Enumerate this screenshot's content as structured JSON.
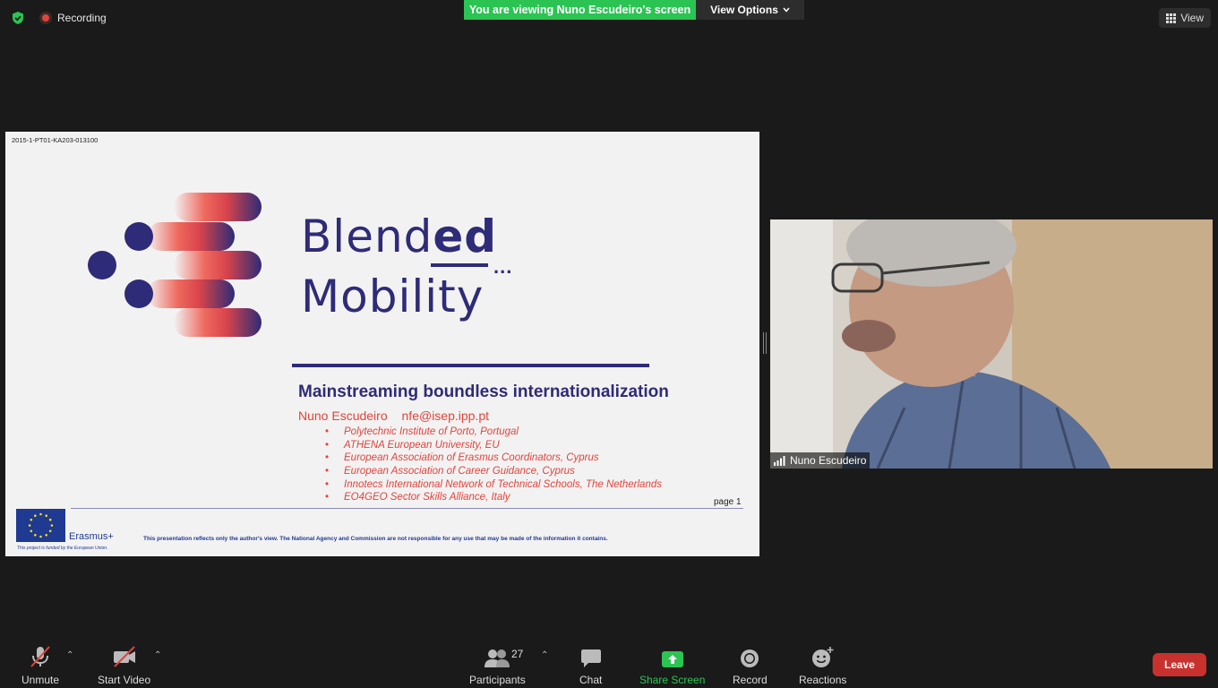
{
  "top_bar": {
    "recording_label": "Recording",
    "viewing_banner": "You are viewing Nuno Escudeiro's screen",
    "view_options_label": "View Options",
    "view_label": "View"
  },
  "slide": {
    "project_code": "2015-1-PT01-KA203-013100",
    "brand_line1_regular": "Blend",
    "brand_line1_bold": "ed",
    "brand_dots": "...",
    "brand_line2": "Mobility",
    "subtitle": "Mainstreaming boundless internationalization",
    "author_name": "Nuno Escudeiro",
    "author_email": "nfe@isep.ipp.pt",
    "affiliations": [
      "Polytechnic Institute of Porto, Portugal",
      "ATHENA European University, EU",
      "European Association of Erasmus Coordinators, Cyprus",
      "European Association of Career Guidance, Cyprus",
      "Innotecs International Network of Technical Schools, The Netherlands",
      "EO4GEO Sector Skills Alliance, Italy"
    ],
    "page_label": "page 1",
    "erasmus_label": "Erasmus+",
    "funded_note": "This project is funded by the European Union.",
    "disclaimer": "This presentation reflects only the author's view. The National Agency and Commission are not responsible for any use that may be made of the information it contains."
  },
  "video": {
    "participant_name": "Nuno Escudeiro"
  },
  "toolbar": {
    "unmute_label": "Unmute",
    "start_video_label": "Start Video",
    "participants_label": "Participants",
    "participants_count": "27",
    "chat_label": "Chat",
    "share_screen_label": "Share Screen",
    "record_label": "Record",
    "reactions_label": "Reactions",
    "leave_label": "Leave"
  },
  "colors": {
    "share_green": "#2bc453",
    "leave_red": "#c8312d",
    "brand_navy": "#2e2b78",
    "brand_red": "#e0443c"
  }
}
